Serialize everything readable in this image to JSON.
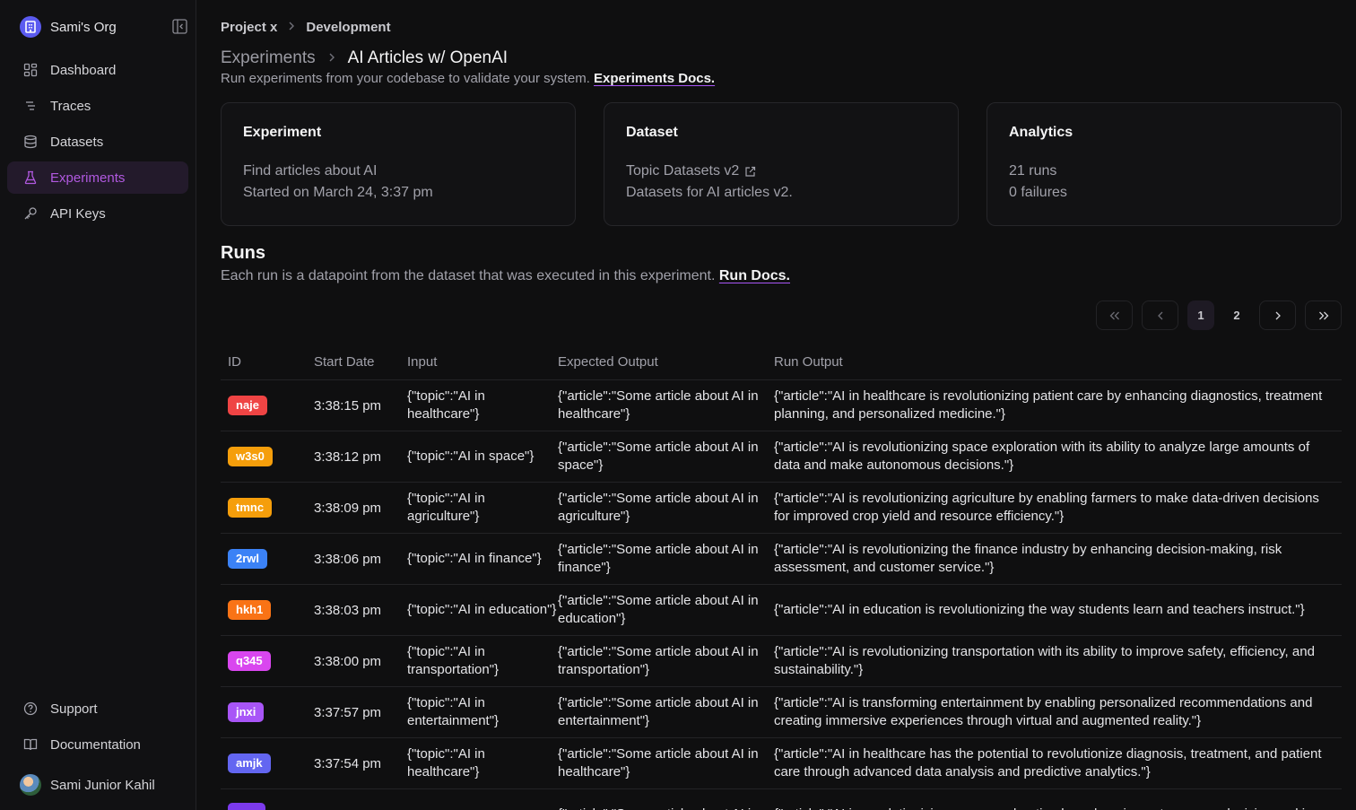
{
  "org": {
    "name": "Sami's Org"
  },
  "sidebar": {
    "items": [
      {
        "label": "Dashboard",
        "icon": "dashboard-icon",
        "active": false
      },
      {
        "label": "Traces",
        "icon": "traces-icon",
        "active": false
      },
      {
        "label": "Datasets",
        "icon": "database-icon",
        "active": false
      },
      {
        "label": "Experiments",
        "icon": "flask-icon",
        "active": true
      },
      {
        "label": "API Keys",
        "icon": "key-icon",
        "active": false
      }
    ],
    "bottom": [
      {
        "label": "Support",
        "icon": "help-icon"
      },
      {
        "label": "Documentation",
        "icon": "book-icon"
      }
    ],
    "user": {
      "name": "Sami Junior Kahil"
    }
  },
  "breadcrumb": {
    "project": "Project x",
    "env": "Development"
  },
  "header": {
    "parent": "Experiments",
    "title": "AI Articles w/ OpenAI",
    "subtitle": "Run experiments from your codebase to validate your system.",
    "docs_link": "Experiments Docs."
  },
  "cards": {
    "experiment": {
      "title": "Experiment",
      "line1": "Find articles about AI",
      "line2": "Started on March 24, 3:37 pm"
    },
    "dataset": {
      "title": "Dataset",
      "line1": "Topic Datasets v2",
      "line2": "Datasets for AI articles v2."
    },
    "analytics": {
      "title": "Analytics",
      "line1": "21 runs",
      "line2": "0 failures"
    }
  },
  "runs": {
    "title": "Runs",
    "subtitle": "Each run is a datapoint from the dataset that was executed in this experiment.",
    "docs_link": "Run Docs."
  },
  "pagination": {
    "current": "1",
    "next": "2"
  },
  "table": {
    "headers": {
      "id": "ID",
      "date": "Start Date",
      "input": "Input",
      "expected": "Expected Output",
      "output": "Run Output"
    },
    "rows": [
      {
        "id": "naje",
        "color": "#ef4444",
        "date": "3:38:15 pm",
        "input": "{\"topic\":\"AI in healthcare\"}",
        "expected": "{\"article\":\"Some article about AI in healthcare\"}",
        "output": "{\"article\":\"AI in healthcare is revolutionizing patient care by enhancing diagnostics, treatment planning, and personalized medicine.\"}"
      },
      {
        "id": "w3s0",
        "color": "#f59e0b",
        "date": "3:38:12 pm",
        "input": "{\"topic\":\"AI in space\"}",
        "expected": "{\"article\":\"Some article about AI in space\"}",
        "output": "{\"article\":\"AI is revolutionizing space exploration with its ability to analyze large amounts of data and make autonomous decisions.\"}"
      },
      {
        "id": "tmnc",
        "color": "#f59e0b",
        "date": "3:38:09 pm",
        "input": "{\"topic\":\"AI in agriculture\"}",
        "expected": "{\"article\":\"Some article about AI in agriculture\"}",
        "output": "{\"article\":\"AI is revolutionizing agriculture by enabling farmers to make data-driven decisions for improved crop yield and resource efficiency.\"}"
      },
      {
        "id": "2rwl",
        "color": "#3b82f6",
        "date": "3:38:06 pm",
        "input": "{\"topic\":\"AI in finance\"}",
        "expected": "{\"article\":\"Some article about AI in finance\"}",
        "output": "{\"article\":\"AI is revolutionizing the finance industry by enhancing decision-making, risk assessment, and customer service.\"}"
      },
      {
        "id": "hkh1",
        "color": "#f97316",
        "date": "3:38:03 pm",
        "input": "{\"topic\":\"AI in education\"}",
        "expected": "{\"article\":\"Some article about AI in education\"}",
        "output": "{\"article\":\"AI in education is revolutionizing the way students learn and teachers instruct.\"}"
      },
      {
        "id": "q345",
        "color": "#d946ef",
        "date": "3:38:00 pm",
        "input": "{\"topic\":\"AI in transportation\"}",
        "expected": "{\"article\":\"Some article about AI in transportation\"}",
        "output": "{\"article\":\"AI is revolutionizing transportation with its ability to improve safety, efficiency, and sustainability.\"}"
      },
      {
        "id": "jnxi",
        "color": "#a855f7",
        "date": "3:37:57 pm",
        "input": "{\"topic\":\"AI in entertainment\"}",
        "expected": "{\"article\":\"Some article about AI in entertainment\"}",
        "output": "{\"article\":\"AI is transforming entertainment by enabling personalized recommendations and creating immersive experiences through virtual and augmented reality.\"}"
      },
      {
        "id": "amjk",
        "color": "#6366f1",
        "date": "3:37:54 pm",
        "input": "{\"topic\":\"AI in healthcare\"}",
        "expected": "{\"article\":\"Some article about AI in healthcare\"}",
        "output": "{\"article\":\"AI in healthcare has the potential to revolutionize diagnosis, treatment, and patient care through advanced data analysis and predictive analytics.\"}"
      },
      {
        "id": "",
        "color": "#7c3aed",
        "date": "",
        "input": "",
        "expected": "{\"article\":\"Some article about AI in",
        "output": "{\"article\":\"AI is revolutionizing space exploration by enhancing autonomous decision-making"
      }
    ]
  }
}
